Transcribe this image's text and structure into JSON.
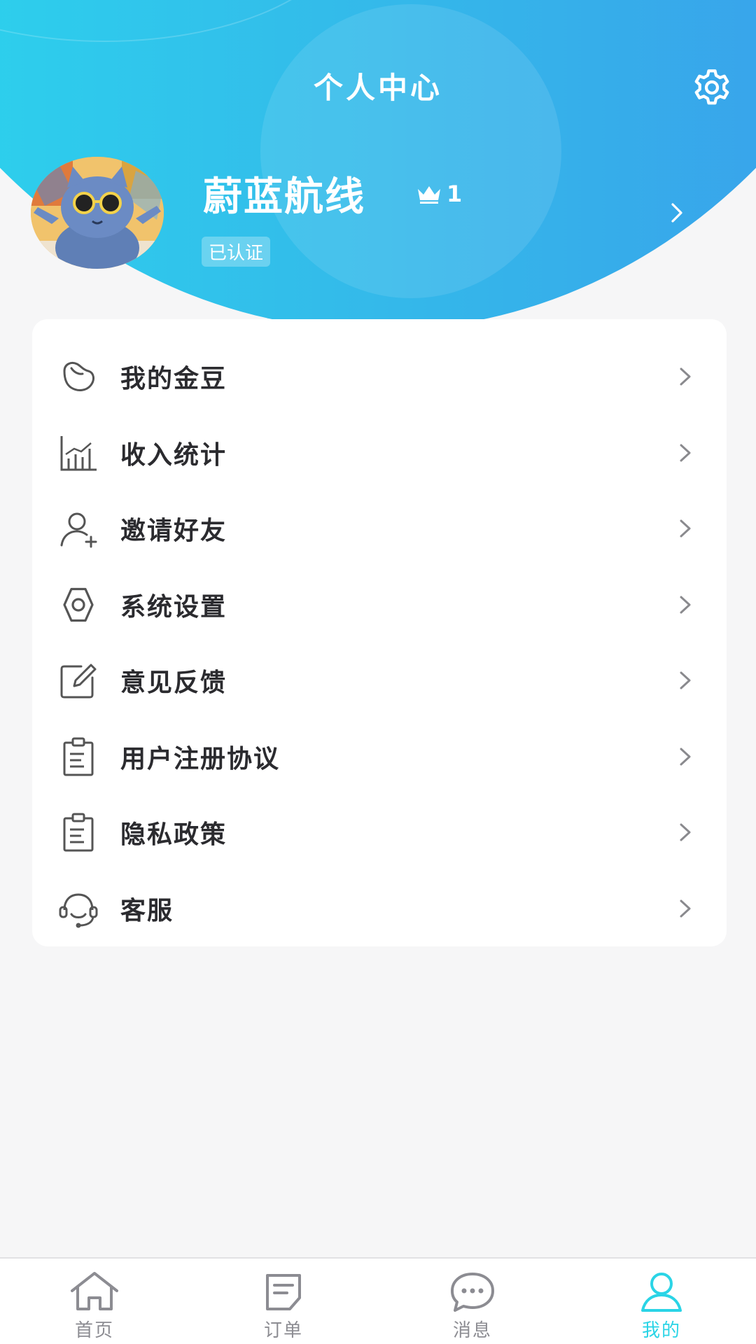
{
  "header": {
    "title": "个人中心",
    "settings_icon": "gear-icon"
  },
  "profile": {
    "name": "蔚蓝航线",
    "level": "1",
    "level_icon": "crown-icon",
    "verified": "已认证"
  },
  "menu": {
    "items": [
      {
        "label": "我的金豆",
        "icon": "bean-icon"
      },
      {
        "label": "收入统计",
        "icon": "bar-chart-icon"
      },
      {
        "label": "邀请好友",
        "icon": "user-plus-icon"
      },
      {
        "label": "系统设置",
        "icon": "gear-icon"
      },
      {
        "label": "意见反馈",
        "icon": "edit-icon"
      },
      {
        "label": "用户注册协议",
        "icon": "clipboard-icon"
      },
      {
        "label": "隐私政策",
        "icon": "clipboard-icon"
      },
      {
        "label": "客服",
        "icon": "headset-icon"
      }
    ]
  },
  "tabs": [
    {
      "label": "首页",
      "icon": "home-icon",
      "active": false
    },
    {
      "label": "订单",
      "icon": "order-icon",
      "active": false
    },
    {
      "label": "消息",
      "icon": "message-icon",
      "active": false
    },
    {
      "label": "我的",
      "icon": "user-icon",
      "active": true
    }
  ],
  "colors": {
    "header_gradient_start": "#2ad8ee",
    "header_gradient_end": "#3a9ceb",
    "accent": "#2ad4e6",
    "menu_text": "#2b2b2f",
    "inactive_tab": "#8c8c92"
  }
}
